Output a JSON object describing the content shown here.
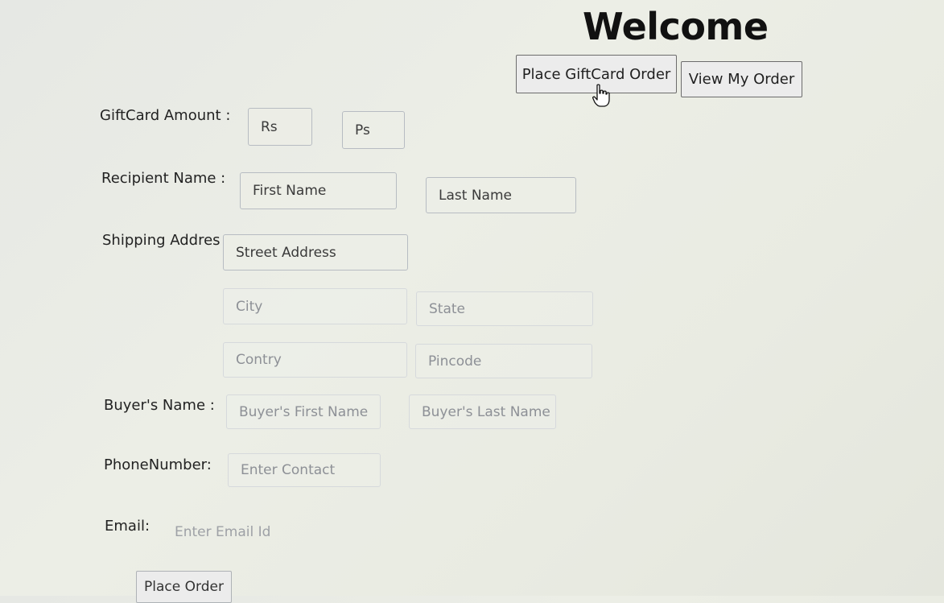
{
  "header": {
    "title": "Welcome",
    "place_giftcard_label": "Place GiftCard Order",
    "view_order_label": "View My Order"
  },
  "form": {
    "giftcard_amount": {
      "label": "GiftCard Amount :",
      "rupees_placeholder": "Rs",
      "paise_placeholder": "Ps"
    },
    "recipient_name": {
      "label": "Recipient Name :",
      "first_placeholder": "First Name",
      "last_placeholder": "Last Name"
    },
    "shipping_address": {
      "label": "Shipping Addres",
      "street_placeholder": "Street Address",
      "city_placeholder": "City",
      "state_placeholder": "State",
      "country_placeholder": "Contry",
      "pincode_placeholder": "Pincode"
    },
    "buyer_name": {
      "label": "Buyer's Name :",
      "first_placeholder": "Buyer's First Name",
      "last_placeholder": "Buyer's Last Name"
    },
    "phone": {
      "label": "PhoneNumber:",
      "placeholder": "Enter Contact"
    },
    "email": {
      "label": "Email:",
      "placeholder": "Enter Email Id"
    },
    "submit_label": "Place Order"
  },
  "cursor": {
    "icon": "hand-pointer-icon"
  }
}
